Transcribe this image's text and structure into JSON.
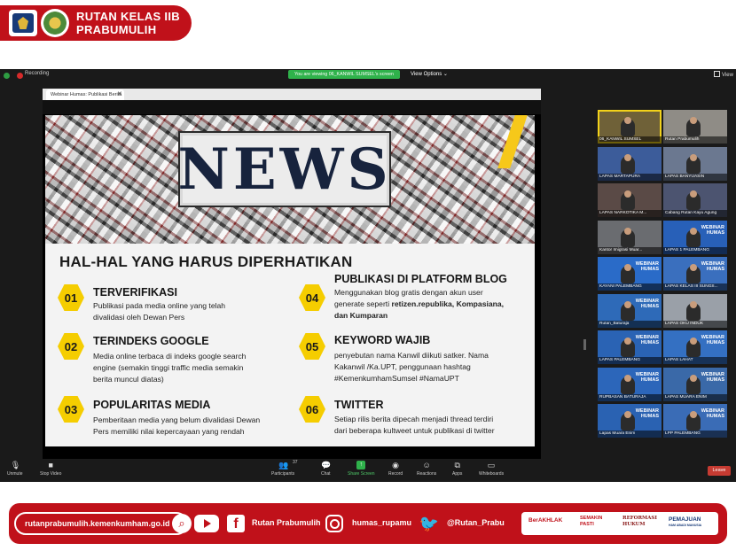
{
  "header": {
    "title_line1": "RUTAN KELAS IIB",
    "title_line2": "PRABUMULIH"
  },
  "zoom": {
    "recording_label": "Recording",
    "viewing_banner": "You are viewing 06_KANWIL SUMSEL's screen",
    "view_options_label": "View Options ⌄",
    "view_label": "View"
  },
  "browser_tab": {
    "title": "Webinar Humas: Publikasi Berita",
    "close_glyph": "✕"
  },
  "slide": {
    "headline": "NEWS",
    "title": "HAL-HAL YANG HARUS DIPERHATIKAN",
    "items": [
      {
        "num": "01",
        "title": "TERVERIFIKASI",
        "desc1": "Publikasi pada media online yang telah",
        "desc2": "divalidasi oleh Dewan Pers",
        "desc3": ""
      },
      {
        "num": "02",
        "title": "TERINDEKS GOOGLE",
        "desc1": "Media online terbaca di indeks google search",
        "desc2": "engine (semakin tinggi traffic media semakin",
        "desc3": "berita muncul diatas)"
      },
      {
        "num": "03",
        "title": "POPULARITAS MEDIA",
        "desc1": "Pemberitaan media yang belum divalidasi  Dewan",
        "desc2": "Pers memiliki nilai kepercayaan yang rendah",
        "desc3": ""
      },
      {
        "num": "04",
        "title": "PUBLIKASI DI PLATFORM BLOG",
        "desc1": "Menggunakan blog gratis dengan akun user",
        "desc2a": "generate seperti ",
        "desc2b": "retizen.republika, Kompasiana,",
        "desc3": "dan Kumparan"
      },
      {
        "num": "05",
        "title": "KEYWORD WAJIB",
        "desc1": "penyebutan nama Kanwil diikuti satker. Nama",
        "desc2": "Kakanwil /Ka.UPT, penggunaan hashtag",
        "desc3": "#KemenkumhamSumsel #NamaUPT"
      },
      {
        "num": "06",
        "title": "TWITTER",
        "desc1": "Setiap rilis berita dipecah menjadi thread terdiri",
        "desc2": "dari beberapa kultweet untuk publikasi di twitter",
        "desc3": ""
      }
    ]
  },
  "gallery": {
    "participants": [
      {
        "name": "06_KANWIL SUMSEL",
        "bg": "#6f6138",
        "webinar": false,
        "active": true
      },
      {
        "name": "Rutan Prabumulih",
        "bg": "#8f8c86",
        "webinar": false,
        "active": false
      },
      {
        "name": "LAPAS MARTAPURA",
        "bg": "#3c5c9a",
        "webinar": false,
        "active": false
      },
      {
        "name": "LAPAS BANYUASIN",
        "bg": "#6b7890",
        "webinar": false,
        "active": false
      },
      {
        "name": "LAPAS NARKOTIKA M...",
        "bg": "#5a4a46",
        "webinar": false,
        "active": false
      },
      {
        "name": "Cabang Rutan Kayu Agung",
        "bg": "#4c5470",
        "webinar": false,
        "active": false
      },
      {
        "name": "Kantor Imigrasi Muar...",
        "bg": "#6a6c70",
        "webinar": false,
        "active": false
      },
      {
        "name": "LAPAS 1 PALEMBANG",
        "bg": "#2860b8",
        "webinar": true,
        "active": false
      },
      {
        "name": "KAYANI PALEMBANG",
        "bg": "#2a6bc8",
        "webinar": true,
        "active": false
      },
      {
        "name": "LAPAS KELAS III SUNGS...",
        "bg": "#3a6fbe",
        "webinar": true,
        "active": false
      },
      {
        "name": "Rutan_Baturaja",
        "bg": "#2e6ab8",
        "webinar": true,
        "active": false
      },
      {
        "name": "LAPAS OKU INDUK",
        "bg": "#9aa0a8",
        "webinar": false,
        "active": false
      },
      {
        "name": "LAPAS PALEMBANG",
        "bg": "#2a63b4",
        "webinar": true,
        "active": false
      },
      {
        "name": "LAPAS LAHAT",
        "bg": "#3470c2",
        "webinar": true,
        "active": false
      },
      {
        "name": "RUPBASAN BATURAJA",
        "bg": "#2c66ba",
        "webinar": true,
        "active": false
      },
      {
        "name": "LAPAS MUARA ENIM",
        "bg": "#3a69a8",
        "webinar": true,
        "active": false
      },
      {
        "name": "Lapas Muara Enim",
        "bg": "#2a62b2",
        "webinar": true,
        "active": false
      },
      {
        "name": "LPP PALEMBANG",
        "bg": "#3a6cb6",
        "webinar": true,
        "active": false
      }
    ],
    "webinar_line1": "WEBINAR",
    "webinar_line2": "HUMAS"
  },
  "toolbar": {
    "unmute": "Unmute",
    "stop_video": "Stop Video",
    "participants": "Participants",
    "participants_count": "37",
    "chat": "Chat",
    "share": "Share Screen",
    "record": "Record",
    "reactions": "Reactions",
    "apps": "Apps",
    "whiteboards": "Whiteboards",
    "leave": "Leave"
  },
  "footer": {
    "url": "rutanprabumulih.kemenkumham.go.id",
    "facebook": "Rutan Prabumulih",
    "instagram": "humas_rupamu",
    "twitter": "@Rutan_Prabu",
    "badge1": "BerAKHLAK",
    "badge2_line1": "SEMAKIN",
    "badge2_line2": "PASTI",
    "badge3_line1": "REFORMASI",
    "badge3_line2": "HUKUM",
    "badge4_line1": "PEMAJUAN",
    "badge4_line2": "HAM ABADI MANUSIA"
  }
}
